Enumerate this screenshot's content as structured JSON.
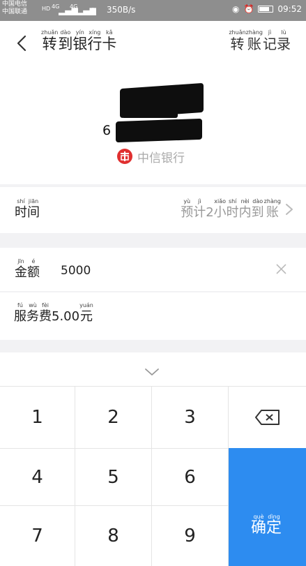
{
  "status_bar": {
    "carrier1": "中国电信",
    "carrier2": "中国联通",
    "hd": "HD",
    "net1": "4G",
    "net2": "4G",
    "speed": "350B/s",
    "time": "09:52"
  },
  "header": {
    "title": [
      {
        "char": "转",
        "pinyin": "zhuǎn"
      },
      {
        "char": "到",
        "pinyin": "dào"
      },
      {
        "char": "银",
        "pinyin": "yín"
      },
      {
        "char": "行",
        "pinyin": "xíng"
      },
      {
        "char": "卡",
        "pinyin": "kǎ"
      }
    ],
    "records": [
      {
        "char": "转",
        "pinyin": "zhuǎn"
      },
      {
        "char": "账",
        "pinyin": "zhàng"
      },
      {
        "char": "记",
        "pinyin": "jì"
      },
      {
        "char": "录",
        "pinyin": "lù"
      }
    ]
  },
  "card": {
    "number_prefix": "6",
    "bank_name": "中信银行"
  },
  "time_row": {
    "label": [
      {
        "char": "时",
        "pinyin": "shí"
      },
      {
        "char": "间",
        "pinyin": "jiān"
      }
    ],
    "value": [
      {
        "char": "预",
        "pinyin": "yù"
      },
      {
        "char": "计",
        "pinyin": "jì"
      },
      {
        "char": "2",
        "pinyin": ""
      },
      {
        "char": "小",
        "pinyin": "xiǎo"
      },
      {
        "char": "时",
        "pinyin": "shí"
      },
      {
        "char": "内",
        "pinyin": "nèi"
      },
      {
        "char": "到",
        "pinyin": "dào"
      },
      {
        "char": "账",
        "pinyin": "zhàng"
      }
    ]
  },
  "amount_row": {
    "label": [
      {
        "char": "金",
        "pinyin": "jīn"
      },
      {
        "char": "额",
        "pinyin": "é"
      }
    ],
    "value": "5000"
  },
  "fee_row": {
    "text": [
      {
        "char": "服",
        "pinyin": "fú"
      },
      {
        "char": "务",
        "pinyin": "wù"
      },
      {
        "char": "费",
        "pinyin": "fèi"
      },
      {
        "char": "5.00",
        "pinyin": ""
      },
      {
        "char": "元",
        "pinyin": "yuán"
      }
    ]
  },
  "keyboard": {
    "keys": [
      "1",
      "2",
      "3",
      "4",
      "5",
      "6",
      "7",
      "8",
      "9"
    ],
    "confirm": [
      {
        "char": "确",
        "pinyin": "què"
      },
      {
        "char": "定",
        "pinyin": "dìng"
      }
    ],
    "accent_color": "#2d8cf0"
  }
}
